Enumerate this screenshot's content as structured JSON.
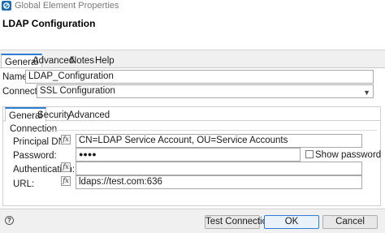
{
  "window": {
    "title": "Global Element Properties"
  },
  "header": {
    "title": "LDAP Configuration"
  },
  "tabs": [
    {
      "label": "General",
      "active": true
    },
    {
      "label": "Advanced",
      "active": false
    },
    {
      "label": "Notes",
      "active": false
    },
    {
      "label": "Help",
      "active": false
    }
  ],
  "general": {
    "name_label": "Name:",
    "name_value": "LDAP_Configuration",
    "connection_label": "Connection",
    "connection_value": "SSL Configuration"
  },
  "inner_tabs": [
    {
      "label": "General",
      "active": true
    },
    {
      "label": "Security",
      "active": false
    },
    {
      "label": "Advanced",
      "active": false
    }
  ],
  "connection": {
    "group_label": "Connection",
    "principal_label": "Principal DN:",
    "principal_value": "CN=LDAP Service Account, OU=Service Accounts",
    "password_label": "Password:",
    "password_value": "●●●●",
    "show_password_label": "Show password",
    "authentication_label": "Authentication:",
    "authentication_value": "",
    "url_label": "URL:",
    "url_value": "ldaps://test.com:636",
    "fx_symbol": "fx"
  },
  "footer": {
    "help_symbol": "?",
    "test_button": "Test Connection...",
    "ok_button": "OK",
    "cancel_button": "Cancel"
  },
  "colors": {
    "accent": "#2d7dd2",
    "icon": "#1f6fb0"
  }
}
